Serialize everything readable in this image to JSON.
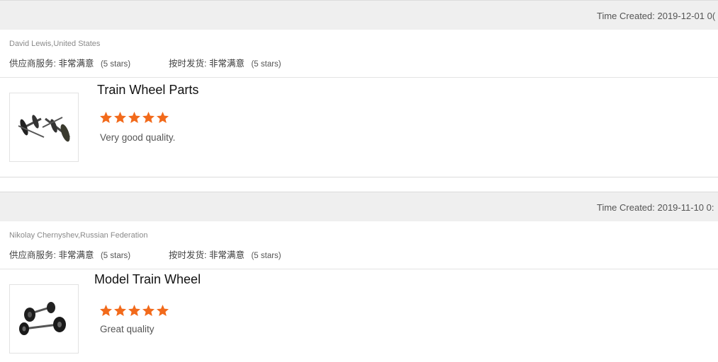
{
  "reviews": [
    {
      "time_created": "Time Created: 2019-12-01 0(",
      "reviewer": "David Lewis,United States",
      "rating1_label": "供应商服务:",
      "rating1_value": "非常满意",
      "rating1_stars": "(5 stars)",
      "rating2_label": "按时发货:",
      "rating2_value": "非常满意",
      "rating2_stars": "(5 stars)",
      "product_title": "Train Wheel Parts",
      "star_rating": 5,
      "comment": "Very good quality."
    },
    {
      "time_created": "Time Created: 2019-11-10 0:",
      "reviewer": "Nikolay Chernyshev,Russian Federation",
      "rating1_label": "供应商服务:",
      "rating1_value": "非常满意",
      "rating1_stars": "(5 stars)",
      "rating2_label": "按时发货:",
      "rating2_value": "非常满意",
      "rating2_stars": "(5 stars)",
      "product_title": "Model Train Wheel",
      "star_rating": 5,
      "comment": "Great quality"
    }
  ],
  "colors": {
    "star": "#f26a1b",
    "time_bar_bg": "#efefef"
  },
  "icons": {
    "star": "star-icon",
    "thumb1": "train-wheel-axle-image",
    "thumb2": "model-wheel-set-image"
  }
}
